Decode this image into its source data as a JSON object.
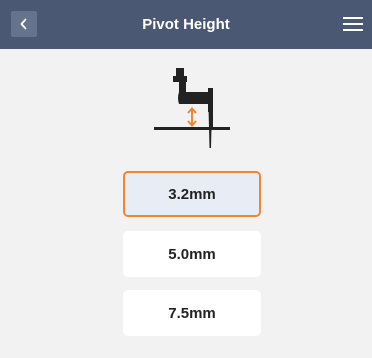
{
  "header": {
    "title": "Pivot Height",
    "back_icon": "chevron-left-icon",
    "menu_icon": "hamburger-menu-icon"
  },
  "illustration": {
    "icon": "presser-foot-pivot-height-icon"
  },
  "options": [
    {
      "label": "3.2mm",
      "selected": true
    },
    {
      "label": "5.0mm",
      "selected": false
    },
    {
      "label": "7.5mm",
      "selected": false
    }
  ],
  "colors": {
    "header_bg": "#4a5873",
    "back_button_bg": "#66738c",
    "selected_border": "#ee8633",
    "selected_bg": "#e8ecf5",
    "page_bg": "#f2f2f2"
  }
}
